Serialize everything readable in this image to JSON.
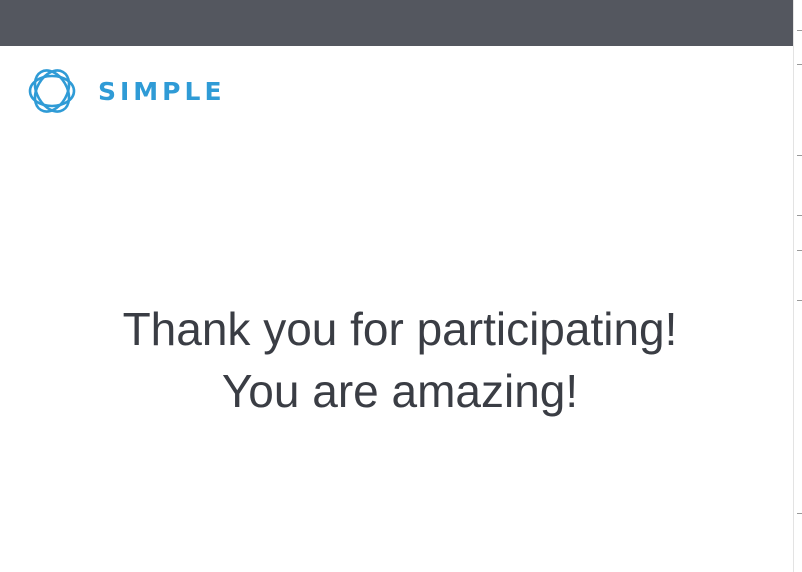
{
  "brand": {
    "logo_text": "SIMPLE",
    "logo_icon": "simple-logo-icon",
    "accent_color": "#2f9bd6"
  },
  "header": {
    "bar_color": "#54575f"
  },
  "message": {
    "line1": "Thank you for participating!",
    "line2": "You are amazing!",
    "text_color": "#3a3d44"
  }
}
